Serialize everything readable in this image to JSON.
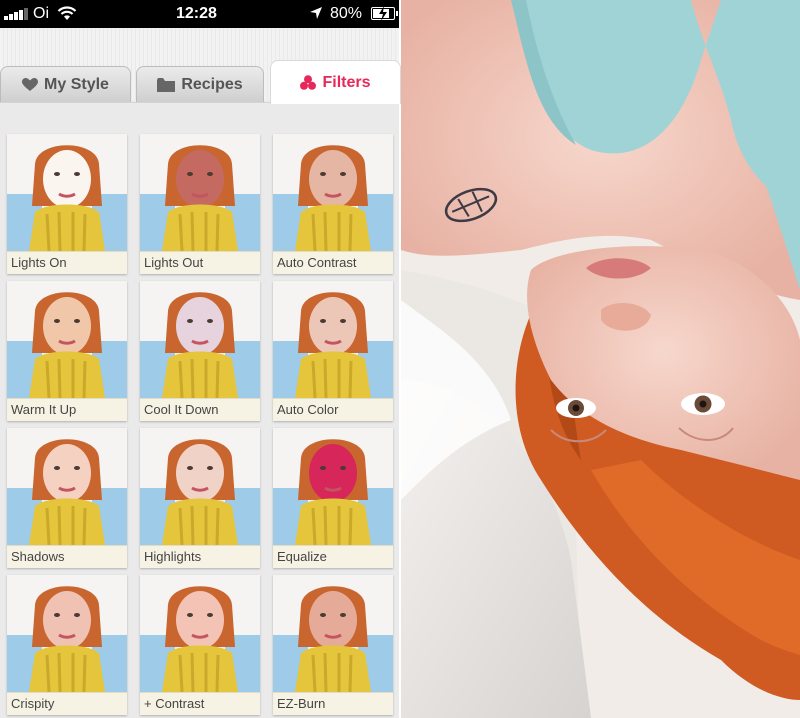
{
  "status_bar": {
    "carrier": "Oi",
    "time": "12:28",
    "battery": "80%",
    "signal_icon": "signal-bars-icon",
    "wifi_icon": "wifi-icon",
    "location_icon": "location-arrow-icon",
    "battery_icon": "battery-charging-icon"
  },
  "tabs": [
    {
      "label": "My Style",
      "icon": "heart-icon",
      "active": false
    },
    {
      "label": "Recipes",
      "icon": "folder-icon",
      "active": false
    },
    {
      "label": "Filters",
      "icon": "filters-icon",
      "active": true
    }
  ],
  "filters": [
    {
      "label": "Lights On",
      "tint": "#fbf5f0"
    },
    {
      "label": "Lights Out",
      "tint": "#c46a60"
    },
    {
      "label": "Auto Contrast",
      "tint": "#e6b6a4"
    },
    {
      "label": "Warm It Up",
      "tint": "#f0c7a8"
    },
    {
      "label": "Cool It Down",
      "tint": "#e7d3dd"
    },
    {
      "label": "Auto Color",
      "tint": "#ecc7b7"
    },
    {
      "label": "Shadows",
      "tint": "#f4d1c0"
    },
    {
      "label": "Highlights",
      "tint": "#f0d3c6"
    },
    {
      "label": "Equalize",
      "tint": "#d6265a"
    },
    {
      "label": "Crispity",
      "tint": "#efc2b4"
    },
    {
      "label": "+ Contrast",
      "tint": "#f3c4b6"
    },
    {
      "label": "EZ-Burn",
      "tint": "#e6ab98"
    }
  ],
  "colors": {
    "active_tab": "#e8285a",
    "label_bg": "#f7f3e4"
  }
}
